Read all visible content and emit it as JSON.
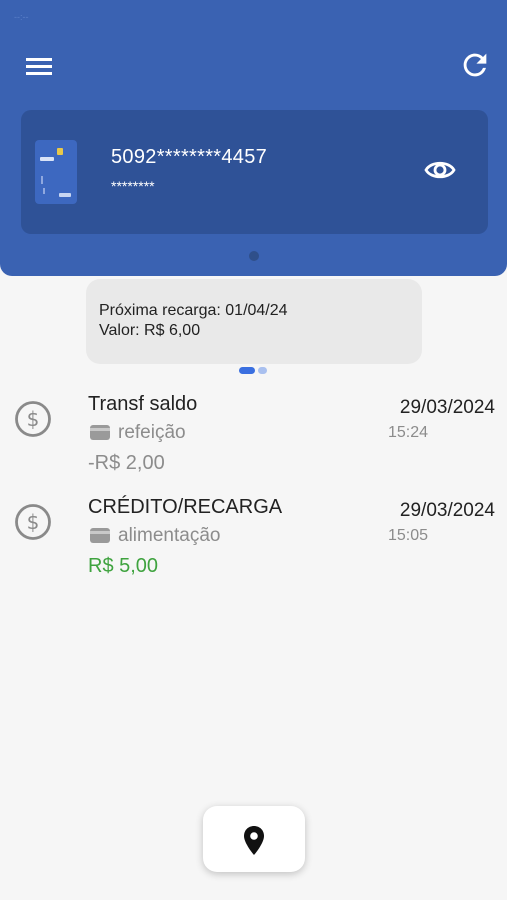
{
  "status_bar": {
    "time": "--:--"
  },
  "header": {
    "menu_icon": "hamburger-menu-icon",
    "refresh_icon": "refresh-icon",
    "background_color": "#3a62b2"
  },
  "card": {
    "number": "5092********4457",
    "holder": "********",
    "visibility_icon": "eye-icon",
    "card_color": "#2f5297"
  },
  "recharge": {
    "next": "Próxima recarga: 01/04/24",
    "value": "Valor: R$ 6,00"
  },
  "transactions": [
    {
      "title": "Transf saldo",
      "category": "refeição",
      "amount": "-R$ 2,00",
      "date": "29/03/2024",
      "time": "15:24",
      "amount_color": "#8c8c8c",
      "icon": "dollar-coin-icon"
    },
    {
      "title": "CRÉDITO/RECARGA",
      "category": "alimentação",
      "amount": "R$ 5,00",
      "date": "29/03/2024",
      "time": "15:05",
      "amount_color": "#3fa33f",
      "icon": "dollar-coin-icon"
    }
  ],
  "fab": {
    "icon": "location-pin-icon"
  }
}
